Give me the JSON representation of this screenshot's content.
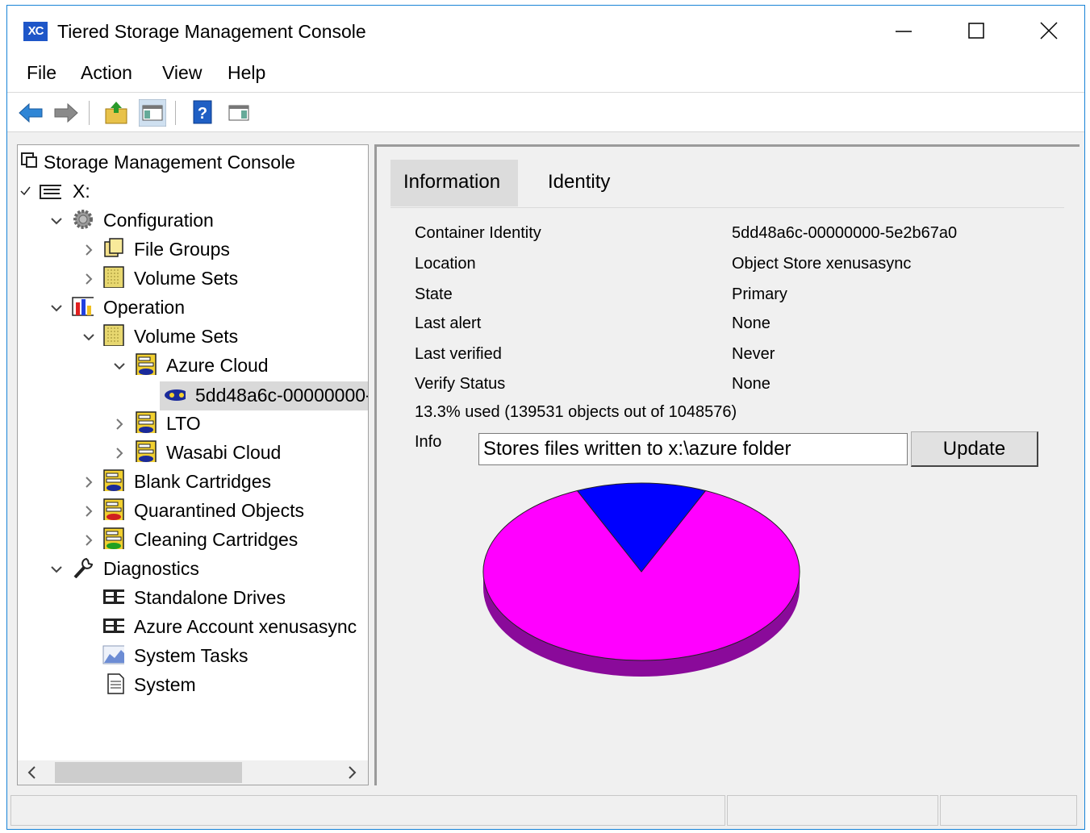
{
  "window": {
    "title": "Tiered Storage Management Console",
    "app_icon_text": "XC",
    "accent": "#1883d7"
  },
  "menu": [
    "File",
    "Action",
    "View",
    "Help"
  ],
  "toolbar": {
    "buttons": [
      "back-icon",
      "forward-icon",
      "up-folder-icon",
      "show-hide-tree-icon",
      "help-icon",
      "action-pane-icon"
    ]
  },
  "tree": {
    "root": "Storage Management Console",
    "drive": "X:",
    "configuration": "Configuration",
    "file_groups": "File Groups",
    "config_volume_sets": "Volume Sets",
    "operation": "Operation",
    "op_volume_sets": "Volume Sets",
    "azure_cloud": "Azure Cloud",
    "container": "5dd48a6c-00000000-",
    "lto": "LTO",
    "wasabi_cloud": "Wasabi Cloud",
    "blank_cartridges": "Blank Cartridges",
    "quarantined_objects": "Quarantined Objects",
    "cleaning_cartridges": "Cleaning Cartridges",
    "diagnostics": "Diagnostics",
    "standalone_drives": "Standalone Drives",
    "azure_account": "Azure Account xenusasync",
    "system_tasks": "System Tasks",
    "system": "System"
  },
  "tabs": {
    "information": "Information",
    "identity": "Identity"
  },
  "properties": {
    "container_identity_label": "Container Identity",
    "container_identity_value": "5dd48a6c-00000000-5e2b67a0",
    "location_label": "Location",
    "location_value": "Object Store xenusasync",
    "state_label": "State",
    "state_value": "Primary",
    "last_alert_label": "Last alert",
    "last_alert_value": "None",
    "last_verified_label": "Last verified",
    "last_verified_value": "Never",
    "verify_status_label": "Verify Status",
    "verify_status_value": "None"
  },
  "usage": {
    "text": "13.3% used (139531 objects out of 1048576)",
    "used_fraction": 0.133,
    "used_color": "#0000ff",
    "free_color": "#ff00ff"
  },
  "info": {
    "label": "Info",
    "value": "Stores files written to x:\\azure folder",
    "update_label": "Update"
  }
}
